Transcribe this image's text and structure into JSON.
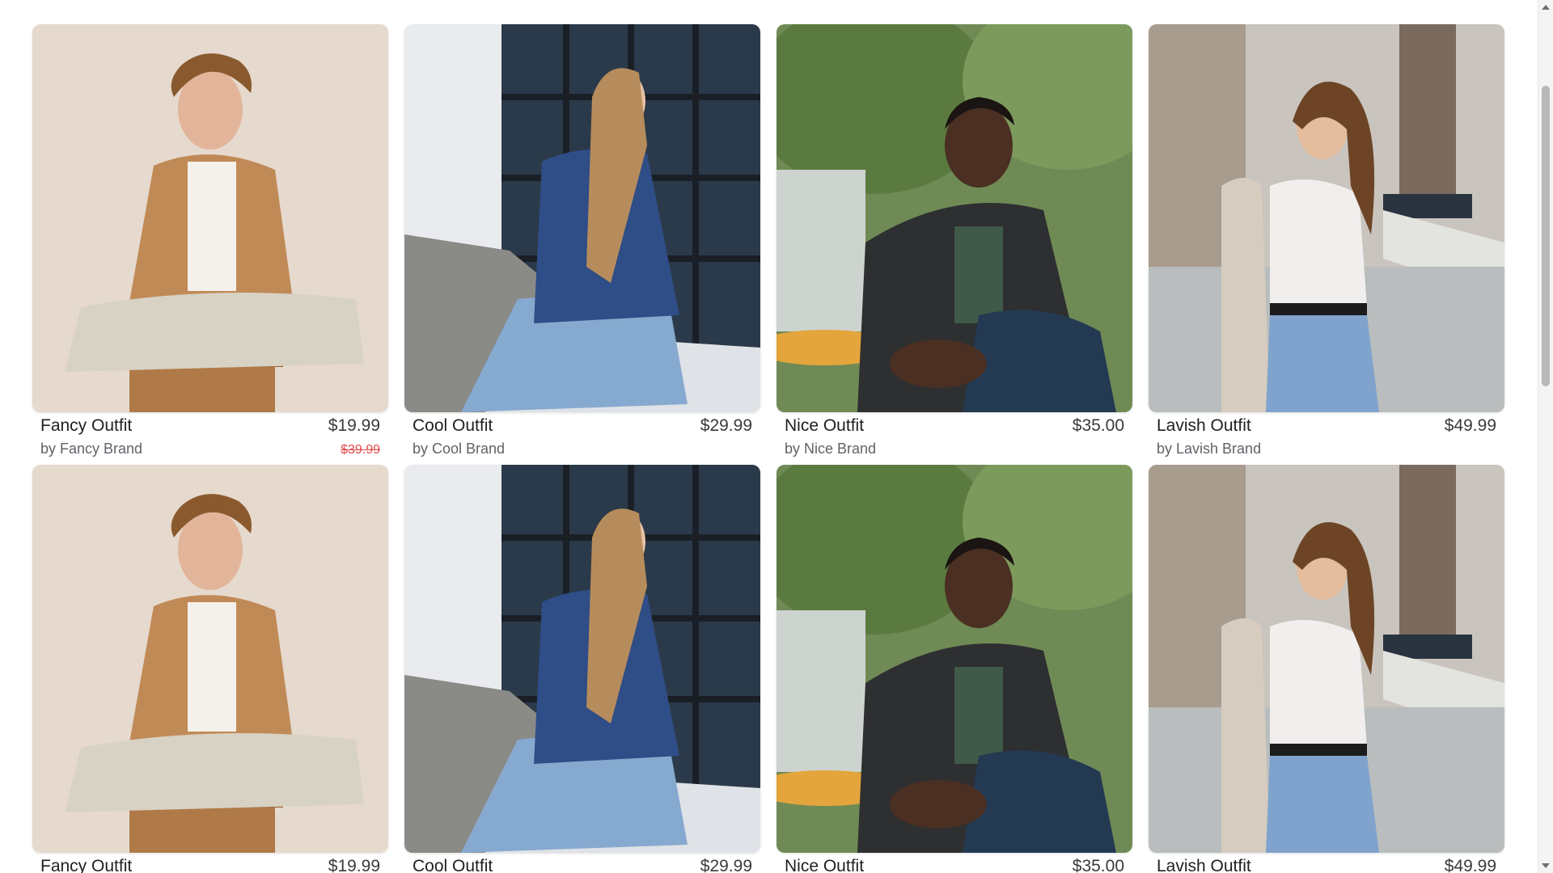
{
  "products": [
    {
      "title": "Fancy Outfit",
      "brand": "by Fancy Brand",
      "price": "$19.99",
      "old_price": "$39.99",
      "photo": "fancy-outfit-photo"
    },
    {
      "title": "Cool Outfit",
      "brand": "by Cool Brand",
      "price": "$29.99",
      "old_price": "",
      "photo": "cool-outfit-photo"
    },
    {
      "title": "Nice Outfit",
      "brand": "by Nice Brand",
      "price": "$35.00",
      "old_price": "",
      "photo": "nice-outfit-photo"
    },
    {
      "title": "Lavish Outfit",
      "brand": "by Lavish Brand",
      "price": "$49.99",
      "old_price": "",
      "photo": "lavish-outfit-photo"
    },
    {
      "title": "Fancy Outfit",
      "brand": "",
      "price": "$19.99",
      "old_price": "",
      "photo": "fancy-outfit-photo"
    },
    {
      "title": "Cool Outfit",
      "brand": "",
      "price": "$29.99",
      "old_price": "",
      "photo": "cool-outfit-photo"
    },
    {
      "title": "Nice Outfit",
      "brand": "",
      "price": "$35.00",
      "old_price": "",
      "photo": "nice-outfit-photo"
    },
    {
      "title": "Lavish Outfit",
      "brand": "",
      "price": "$49.99",
      "old_price": "",
      "photo": "lavish-outfit-photo"
    }
  ],
  "colors": {
    "sale_price": "#e04b4b",
    "title_text": "#1f1f1f",
    "brand_text": "#5f6368"
  }
}
